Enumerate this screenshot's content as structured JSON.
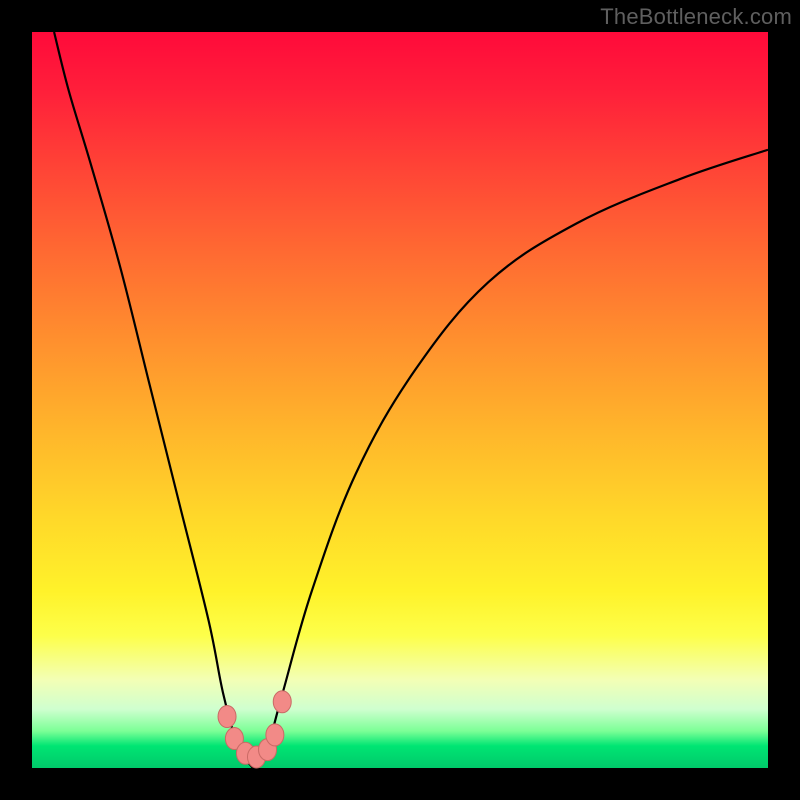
{
  "watermark": "TheBottleneck.com",
  "colors": {
    "frame_bg": "#000000",
    "gradient_top": "#ff0a3a",
    "gradient_mid": "#ffd829",
    "gradient_bottom": "#00c96a",
    "curve_stroke": "#000000",
    "marker_fill": "#f28a87",
    "marker_stroke": "#c96a65"
  },
  "chart_data": {
    "type": "line",
    "title": "",
    "xlabel": "",
    "ylabel": "",
    "xlim": [
      0,
      100
    ],
    "ylim": [
      0,
      100
    ],
    "grid": false,
    "legend": false,
    "note": "V-shaped bottleneck curve; y≈100 means high bottleneck (red), y≈0 means balanced (green). Minimum around x≈30. Values estimated from pixel positions.",
    "series": [
      {
        "name": "left-branch",
        "x": [
          3,
          5,
          8,
          12,
          16,
          20,
          24,
          26,
          28,
          30
        ],
        "y": [
          100,
          92,
          82,
          68,
          52,
          36,
          20,
          10,
          3,
          0
        ]
      },
      {
        "name": "right-branch",
        "x": [
          30,
          32,
          34,
          38,
          44,
          52,
          62,
          74,
          88,
          100
        ],
        "y": [
          0,
          3,
          10,
          24,
          40,
          54,
          66,
          74,
          80,
          84
        ]
      }
    ],
    "markers": {
      "name": "near-optimum-points",
      "x": [
        26.5,
        27.5,
        29.0,
        30.5,
        32.0,
        33.0,
        34.0
      ],
      "y": [
        7.0,
        4.0,
        2.0,
        1.5,
        2.5,
        4.5,
        9.0
      ]
    }
  }
}
